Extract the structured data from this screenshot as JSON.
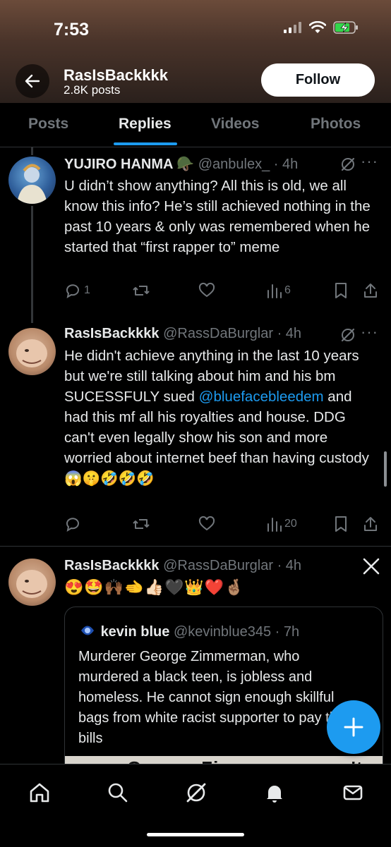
{
  "status_bar": {
    "time": "7:53"
  },
  "profile": {
    "name": "RasIsBackkkk",
    "posts": "2.8K posts",
    "follow_label": "Follow"
  },
  "tabs": [
    {
      "label": "Posts"
    },
    {
      "label": "Replies"
    },
    {
      "label": "Videos"
    },
    {
      "label": "Photos"
    }
  ],
  "posts": [
    {
      "name": "YUJIRO HANMA 🪖",
      "handle": "@anbulex_ · 4h",
      "text": "U didn’t show anything? All this is old, we all know this info? He’s still achieved nothing in the past 10 years & only was remembered when he started that “first rapper to” meme",
      "replies": "1",
      "reposts": "",
      "likes": "",
      "views": "6"
    },
    {
      "name": "RasIsBackkkk",
      "handle": "@RassDaBurglar · 4h",
      "text_before": "He didn't achieve anything in the last 10 years but we're still talking about him and his bm SUCESSFULY sued ",
      "mention": "@bluefacebleedem",
      "text_after": " and had this mf all his royalties and house. DDG can't even legally show his son and more worried about internet beef than having custody😱🤫🤣🤣🤣",
      "replies": "",
      "reposts": "",
      "likes": "",
      "views": "20"
    },
    {
      "name": "RasIsBackkkk",
      "handle": "@RassDaBurglar · 4h",
      "text": "😍🤩🙌🏾🫲👍🏻🖤👑❤️🤞🏽",
      "quote": {
        "name": "kevin blue",
        "handle": "@kevinblue345 · 7h",
        "text": "Murderer George Zimmerman, who murdered a black teen, is jobless and homeless. He cannot sign enough skillful bags from white racist supporter to pay the bills",
        "image_caption": "George Zimmerman can't"
      }
    }
  ],
  "colors": {
    "accent": "#1d9bf0",
    "muted": "#71767b",
    "text": "#e7e9ea",
    "border": "#2f3336"
  }
}
